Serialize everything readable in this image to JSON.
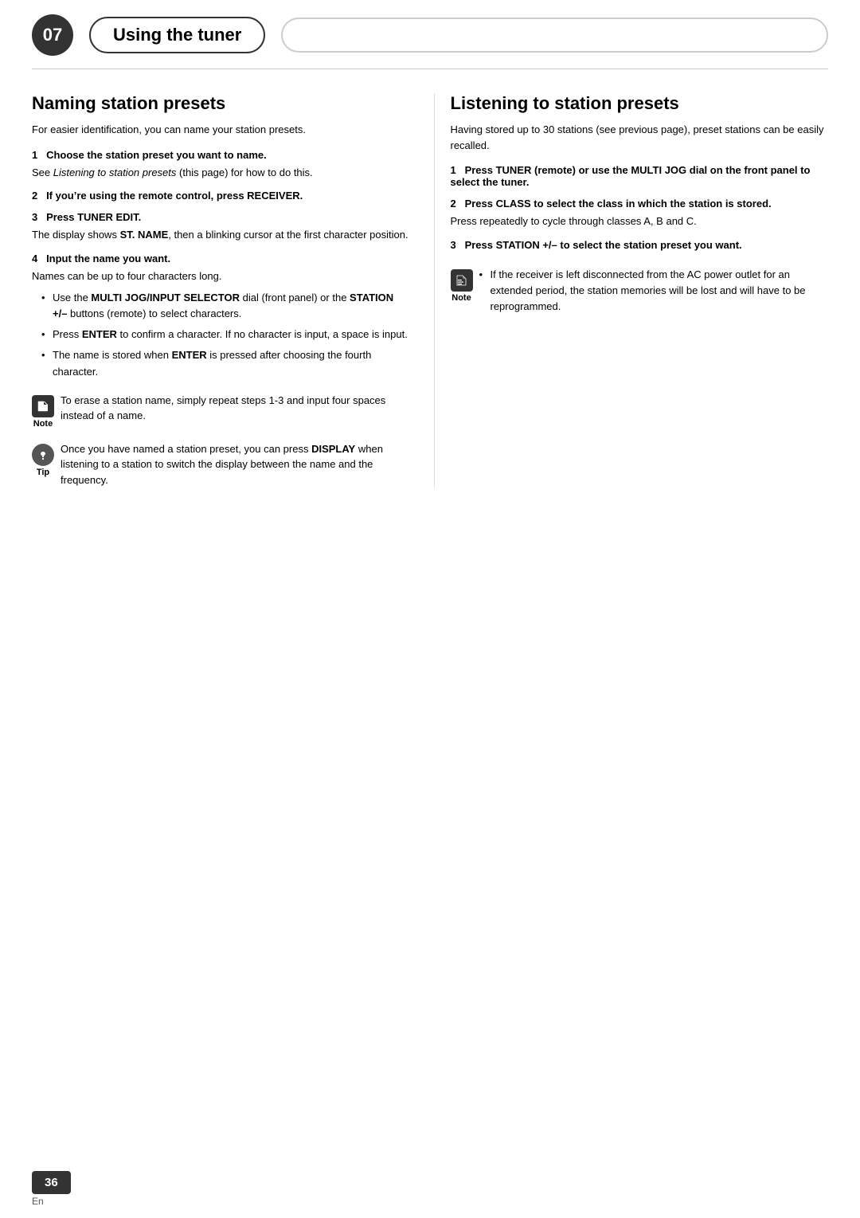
{
  "header": {
    "chapter_number": "07",
    "chapter_title": "Using the tuner"
  },
  "footer": {
    "page_number": "36",
    "language": "En"
  },
  "left_section": {
    "title": "Naming station presets",
    "intro": "For easier identification, you can name your station presets.",
    "steps": [
      {
        "number": "1",
        "heading": "Choose the station preset you want to name.",
        "body_parts": [
          {
            "text": "See ",
            "italic_text": "Listening to station presets",
            "after_text": " (this page) for how to do this."
          }
        ]
      },
      {
        "number": "2",
        "heading": "If you’re using the remote control, press RECEIVER.",
        "body_parts": []
      },
      {
        "number": "3",
        "heading": "Press TUNER EDIT.",
        "body_parts": [
          {
            "plain": "The display shows ",
            "bold": "ST. NAME",
            "after": ", then a blinking cursor at the first character position."
          }
        ]
      },
      {
        "number": "4",
        "heading": "Input the name you want.",
        "body_parts": [
          {
            "plain": "Names can be up to four characters long."
          }
        ]
      }
    ],
    "bullets": [
      {
        "parts": [
          {
            "plain": "Use the "
          },
          {
            "bold": "MULTI JOG/INPUT SELECTOR"
          },
          {
            "plain": " dial (front panel) or the "
          },
          {
            "bold": "STATION +/–"
          },
          {
            "plain": " buttons (remote) to select characters."
          }
        ]
      },
      {
        "parts": [
          {
            "plain": "Press "
          },
          {
            "bold": "ENTER"
          },
          {
            "plain": " to confirm a character. If no character is input, a space is input."
          }
        ]
      },
      {
        "parts": [
          {
            "plain": "The name is stored when "
          },
          {
            "bold": "ENTER"
          },
          {
            "plain": " is pressed after choosing the fourth character."
          }
        ]
      }
    ],
    "note": {
      "label": "Note",
      "text": "To erase a station name, simply repeat steps 1-3 and input four spaces instead of a name."
    },
    "tip": {
      "label": "Tip",
      "text": "Once you have named a station preset, you can press DISPLAY when listening to a station to switch the display between the name and the frequency.",
      "bold_word": "DISPLAY"
    }
  },
  "right_section": {
    "title": "Listening to station presets",
    "intro": "Having stored up to 30 stations (see previous page), preset stations can be easily recalled.",
    "steps": [
      {
        "number": "1",
        "heading": "Press TUNER (remote) or use the MULTI JOG dial on the front panel to select the tuner."
      },
      {
        "number": "2",
        "heading": "Press CLASS to select the class in which the station is stored.",
        "body": "Press repeatedly to cycle through classes A, B and C."
      },
      {
        "number": "3",
        "heading": "Press STATION +/– to select the station preset you want."
      }
    ],
    "note": {
      "label": "Note",
      "bullets": [
        {
          "plain": "If the receiver is left disconnected from the AC power outlet for an extended period, the station memories will be lost and will have to be reprogrammed."
        }
      ]
    }
  }
}
